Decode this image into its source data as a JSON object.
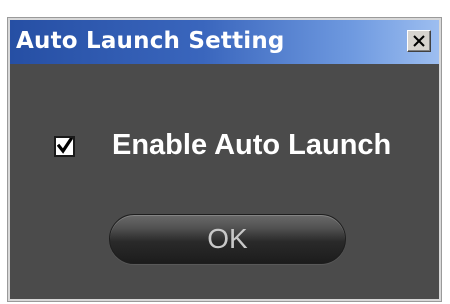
{
  "window": {
    "title": "Auto Launch Setting",
    "close_icon": "close-icon"
  },
  "options": {
    "enable_auto_launch": {
      "label": "Enable Auto Launch",
      "checked": true
    }
  },
  "buttons": {
    "ok_label": "OK"
  },
  "colors": {
    "title_bar_start": "#264fa4",
    "title_bar_end": "#9dbef0",
    "dialog_background": "#4b4b4b",
    "text": "#ffffff"
  }
}
